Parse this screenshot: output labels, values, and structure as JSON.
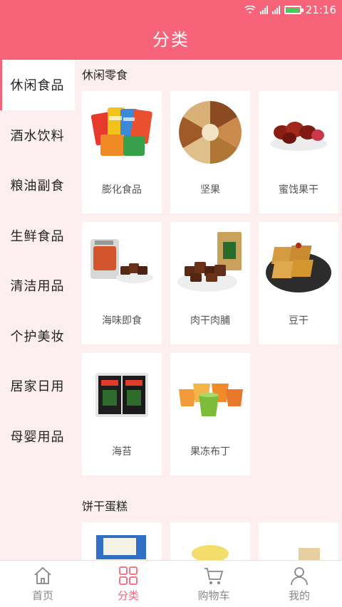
{
  "status_bar": {
    "time": "21:16"
  },
  "header": {
    "title": "分类"
  },
  "sidebar": {
    "items": [
      {
        "label": "休闲食品",
        "active": true
      },
      {
        "label": "酒水饮料",
        "active": false
      },
      {
        "label": "粮油副食",
        "active": false
      },
      {
        "label": "生鲜食品",
        "active": false
      },
      {
        "label": "清洁用品",
        "active": false
      },
      {
        "label": "个护美妆",
        "active": false
      },
      {
        "label": "居家日用",
        "active": false
      },
      {
        "label": "母婴用品",
        "active": false
      }
    ]
  },
  "sections": [
    {
      "title": "休闲零食",
      "items": [
        {
          "label": "膨化食品",
          "icon": "snack-bags-image"
        },
        {
          "label": "坚果",
          "icon": "nuts-plate-image"
        },
        {
          "label": "蜜饯果干",
          "icon": "dried-fruit-image"
        },
        {
          "label": "海味即食",
          "icon": "seafood-snack-image"
        },
        {
          "label": "肉干肉脯",
          "icon": "jerky-image"
        },
        {
          "label": "豆干",
          "icon": "tofu-jerky-image"
        },
        {
          "label": "海苔",
          "icon": "seaweed-image"
        },
        {
          "label": "果冻布丁",
          "icon": "jelly-pudding-image"
        }
      ]
    },
    {
      "title": "饼干蛋糕",
      "items": [
        {
          "label": "",
          "icon": "biscuit-box-image"
        },
        {
          "label": "",
          "icon": "noodle-snack-image"
        },
        {
          "label": "",
          "icon": "cake-image"
        }
      ]
    }
  ],
  "tabbar": {
    "tabs": [
      {
        "label": "首页",
        "icon": "home-icon",
        "active": false
      },
      {
        "label": "分类",
        "icon": "grid-icon",
        "active": true
      },
      {
        "label": "购物车",
        "icon": "cart-icon",
        "active": false
      },
      {
        "label": "我的",
        "icon": "user-icon",
        "active": false
      }
    ]
  },
  "colors": {
    "accent": "#f7647a",
    "background": "#fdeff0",
    "card": "#ffffff",
    "active_indicator": "#f7647a"
  }
}
